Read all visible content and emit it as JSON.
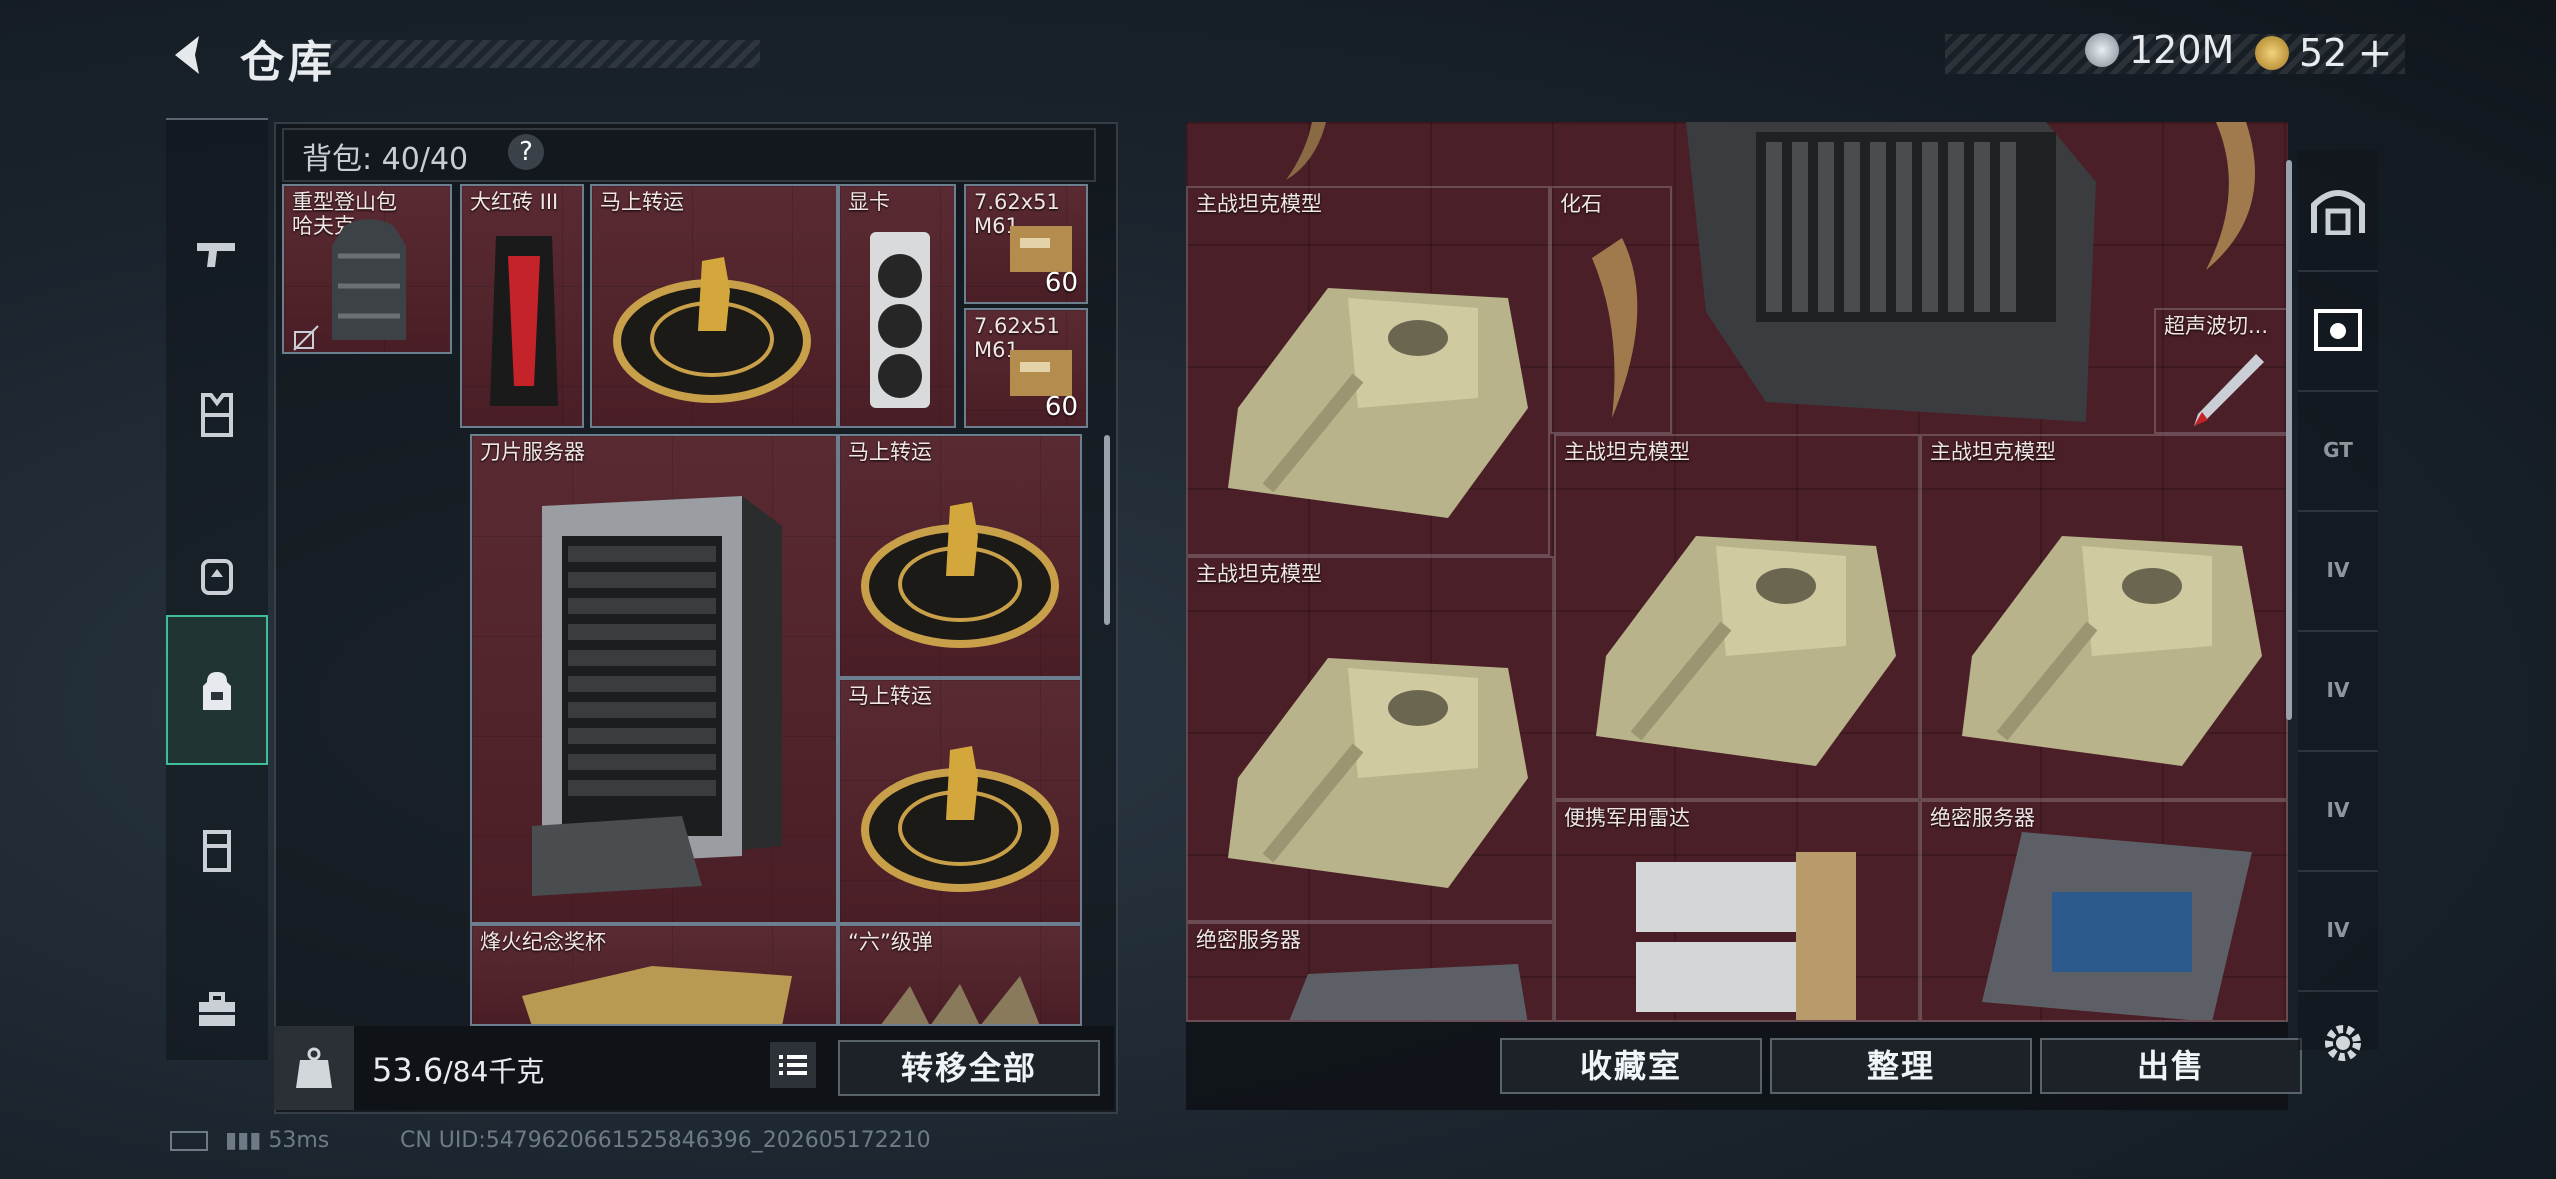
{
  "header": {
    "title": "仓库",
    "currency1": "120M",
    "currency2": "52",
    "currency2_add": "+"
  },
  "nav": {
    "items": [
      "weapon-icon",
      "armor-icon",
      "helmet-icon",
      "backpack-icon",
      "rig-icon",
      "toolbox-icon"
    ],
    "active_index": 3
  },
  "backpack": {
    "label": "背包:",
    "capacity": "40/40",
    "help": "?",
    "items": [
      {
        "label": "重型登山包\n哈夫克",
        "count": ""
      },
      {
        "label": "大红砖 III",
        "count": ""
      },
      {
        "label": "马上转运",
        "count": ""
      },
      {
        "label": "显卡",
        "count": ""
      },
      {
        "label": "7.62x51\nM61",
        "count": "60"
      },
      {
        "label": "7.62x51\nM61",
        "count": "60"
      },
      {
        "label": "刀片服务器",
        "count": ""
      },
      {
        "label": "马上转运",
        "count": ""
      },
      {
        "label": "马上转运",
        "count": ""
      },
      {
        "label": "烽火纪念奖杯",
        "count": ""
      },
      {
        "label": "“六”级弹",
        "count": ""
      }
    ],
    "weight_current": "53.6",
    "weight_max": "/84千克",
    "transfer_all": "转移全部"
  },
  "storage": {
    "items": [
      {
        "label": "主战坦克模型"
      },
      {
        "label": "化石"
      },
      {
        "label": "超声波切..."
      },
      {
        "label": "主战坦克模型"
      },
      {
        "label": "主战坦克模型"
      },
      {
        "label": "主战坦克模型"
      },
      {
        "label": "便携军用雷达"
      },
      {
        "label": "绝密服务器"
      },
      {
        "label": "绝密服务器"
      }
    ],
    "buttons": {
      "collection": "收藏室",
      "sort": "整理",
      "sell": "出售"
    }
  },
  "right_tabs": [
    "vault-icon",
    "filter-tag-icon",
    "GT",
    "IV",
    "IV",
    "IV",
    "IV"
  ],
  "status": {
    "ping": "53ms",
    "uid": "CN UID:5479620661525846396_202605172210"
  },
  "colors": {
    "accent": "#3fbd98",
    "slot_red": "#4b1f27",
    "slot_border": "#6b7f8f"
  }
}
